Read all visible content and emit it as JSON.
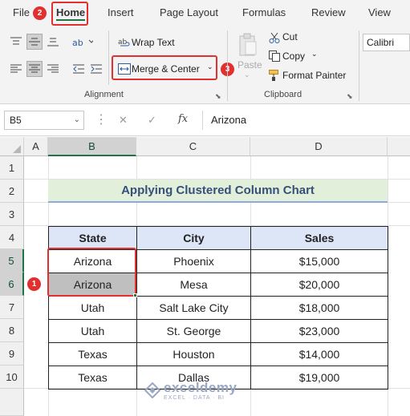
{
  "ribbon_tabs": [
    "File",
    "Home",
    "Insert",
    "Page Layout",
    "Formulas",
    "Review",
    "View"
  ],
  "badges": {
    "one": "1",
    "two": "2",
    "three": "3"
  },
  "alignment_group": {
    "wrap_text": "Wrap Text",
    "merge_center": "Merge & Center",
    "label": "Alignment"
  },
  "clipboard_group": {
    "paste": "Paste",
    "cut": "Cut",
    "copy": "Copy",
    "format_painter": "Format Painter",
    "label": "Clipboard"
  },
  "font_group": {
    "font_name": "Calibri"
  },
  "formula_bar": {
    "name_box": "B5",
    "fx": "fx",
    "content": "Arizona"
  },
  "columns": [
    "A",
    "B",
    "C",
    "D"
  ],
  "rows": [
    "1",
    "2",
    "3",
    "4",
    "5",
    "6",
    "7",
    "8",
    "9",
    "10"
  ],
  "sheet": {
    "title": "Applying Clustered Column Chart",
    "headers": [
      "State",
      "City",
      "Sales"
    ],
    "data": [
      [
        "Arizona",
        "Phoenix",
        "$15,000"
      ],
      [
        "Arizona",
        "Mesa",
        "$20,000"
      ],
      [
        "Utah",
        "Salt Lake City",
        "$18,000"
      ],
      [
        "Utah",
        "St. George",
        "$23,000"
      ],
      [
        "Texas",
        "Houston",
        "$14,000"
      ],
      [
        "Texas",
        "Dallas",
        "$19,000"
      ]
    ]
  },
  "watermark": {
    "name": "exceldemy",
    "tagline": "EXCEL · DATA · BI"
  },
  "colors": {
    "accent": "#217346",
    "callout": "#e0302f",
    "title_fill": "#e2efda",
    "header_fill": "#dde6f6",
    "selection": "#bfbfbf"
  }
}
